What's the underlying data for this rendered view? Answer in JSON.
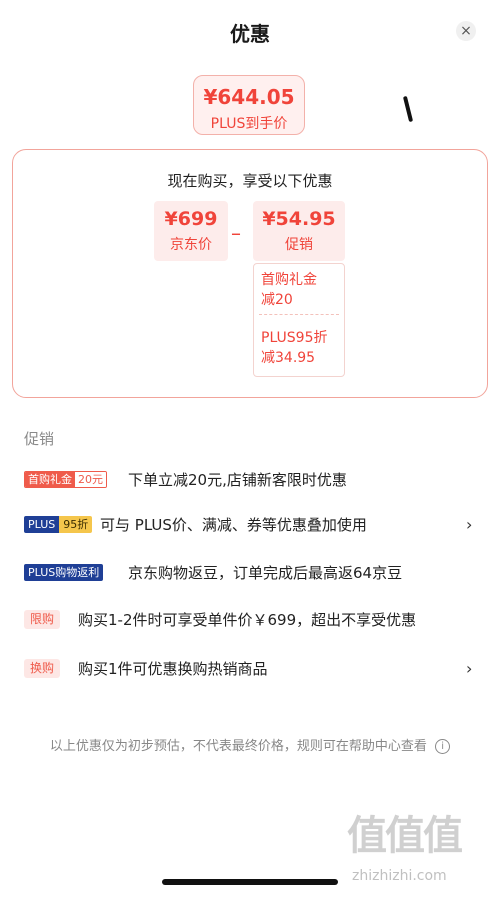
{
  "header": {
    "title": "优惠",
    "close_icon": "×"
  },
  "plus_price": {
    "amount": "¥644.05",
    "label": "PLUS到手价"
  },
  "breakdown": {
    "title": "现在购买，享受以下优惠",
    "jd_price": {
      "amount": "¥699",
      "label": "京东价"
    },
    "operator": "–",
    "promo": {
      "amount": "¥54.95",
      "label": "促销"
    },
    "promo_details": [
      {
        "line1": "首购礼金",
        "line2": "减20"
      },
      {
        "line1": "PLUS95折",
        "line2": "减34.95"
      }
    ]
  },
  "promotions": {
    "section_label": "促销",
    "items": [
      {
        "tag_a": "首购礼金",
        "tag_b": "20元",
        "text": "下单立减20元,店铺新客限时优惠"
      },
      {
        "tag_a": "PLUS",
        "tag_b": "95折",
        "text": "可与 PLUS价、满减、券等优惠叠加使用"
      },
      {
        "tag": "PLUS购物返利",
        "text": "京东购物返豆，订单完成后最高返64京豆"
      },
      {
        "tag": "限购",
        "text": "购买1-2件时可享受单件价￥699，超出不享受优惠"
      },
      {
        "tag": "换购",
        "text": "购买1件可优惠换购热销商品"
      }
    ]
  },
  "footer": {
    "note": "以上优惠仅为初步预估，不代表最终价格，规则可在帮助中心查看",
    "info_icon": "i"
  },
  "watermark": {
    "logo": "值值值",
    "text": "zhizhizhi.com"
  },
  "colors": {
    "accent": "#f0443a",
    "plus_blue": "#1f3f96",
    "plus_gold": "#f5c64c"
  }
}
